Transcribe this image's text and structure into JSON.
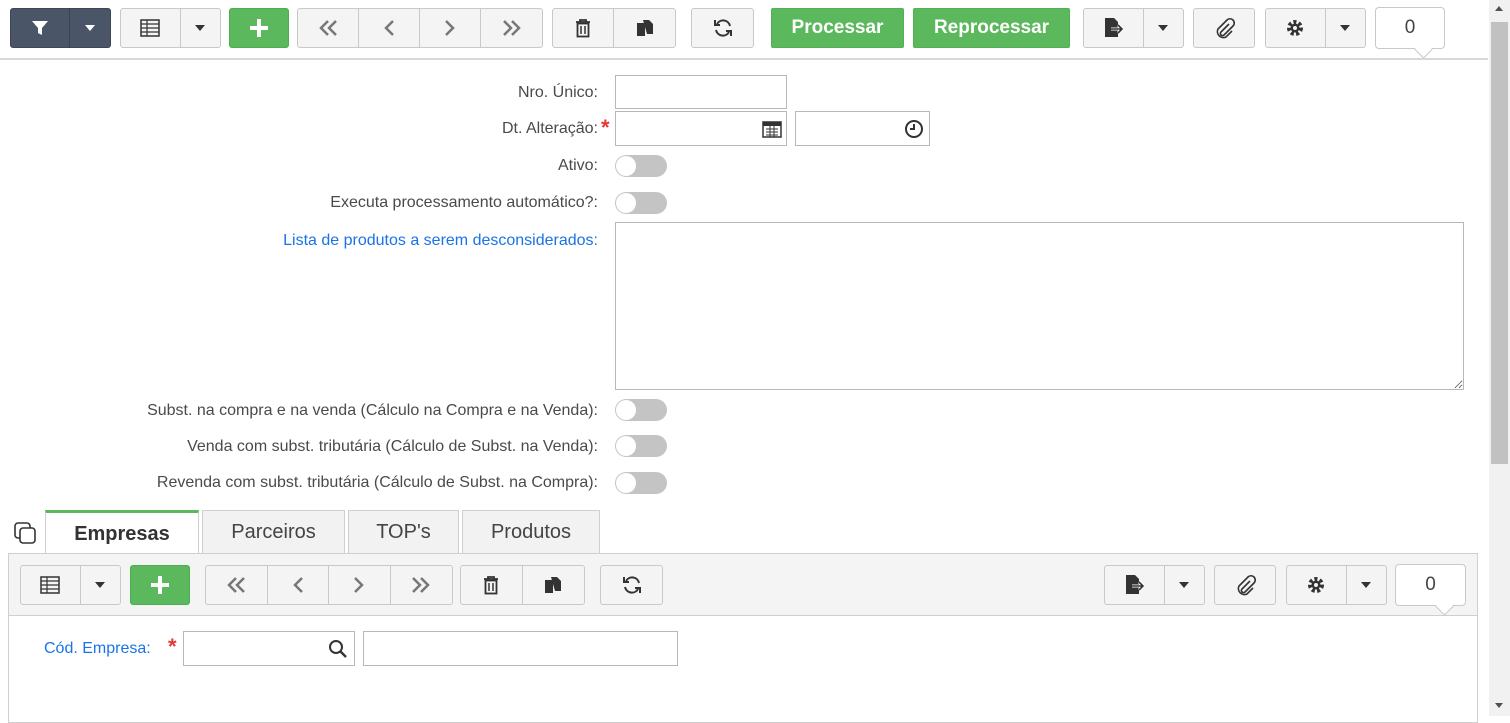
{
  "toolbar": {
    "processar_label": "Processar",
    "reprocessar_label": "Reprocessar",
    "counter": "0"
  },
  "form": {
    "nro_unico_label": "Nro. Único:",
    "nro_unico_value": "",
    "dt_alteracao_label": "Dt. Alteração:",
    "dt_alteracao_date": "",
    "dt_alteracao_time": "",
    "ativo_label": "Ativo:",
    "executa_label": "Executa processamento automático?:",
    "lista_label": "Lista de produtos a serem desconsiderados:",
    "lista_value": "",
    "subst_compra_venda_label": "Subst. na compra e na venda (Cálculo na Compra e na Venda):",
    "venda_subst_label": "Venda com subst. tributária (Cálculo de Subst. na Venda):",
    "revenda_subst_label": "Revenda com subst. tributária (Cálculo de Subst. na Compra):",
    "toggles": {
      "ativo": false,
      "executa": false,
      "subst_compra_venda": false,
      "venda_subst": false,
      "revenda_subst": false
    }
  },
  "tabs": [
    {
      "label": "Empresas",
      "active": true
    },
    {
      "label": "Parceiros",
      "active": false
    },
    {
      "label": "TOP's",
      "active": false
    },
    {
      "label": "Produtos",
      "active": false
    }
  ],
  "detail": {
    "counter": "0",
    "cod_empresa_label": "Cód. Empresa:",
    "cod_empresa_value": "",
    "empresa_nome_value": ""
  },
  "colors": {
    "green": "#5cb85c",
    "link": "#1a73e8",
    "dark_button": "#4a5668",
    "required": "#e53935"
  }
}
